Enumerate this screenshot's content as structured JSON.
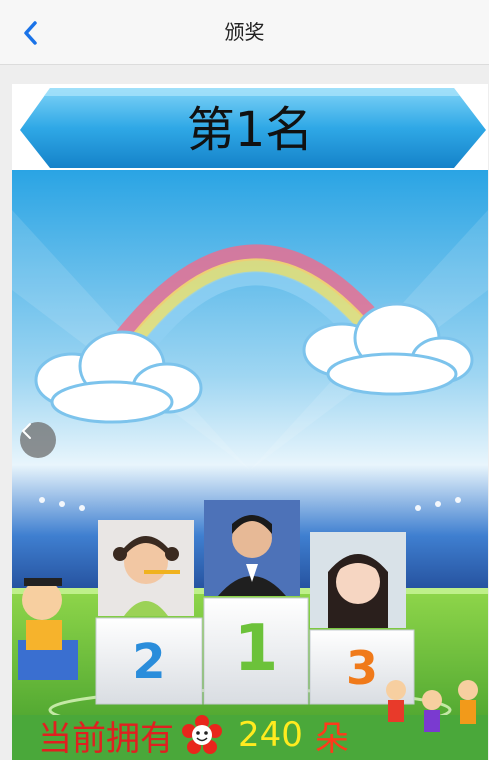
{
  "header": {
    "back_icon": "chevron-left-icon",
    "title": "颁奖"
  },
  "banner": {
    "rank_title": "第1名"
  },
  "carousel": {
    "prev_icon": "chevron-left-icon"
  },
  "podium": {
    "places": [
      "2",
      "1",
      "3"
    ],
    "photos": [
      "child-girl-toothbrush-photo",
      "man-portrait-photo",
      "child-girl-portrait-photo"
    ]
  },
  "points": {
    "label": "当前拥有",
    "icon": "flower-icon",
    "value": "240",
    "unit": "朵"
  },
  "colors": {
    "accent_blue": "#1a73e8",
    "banner_blue": "#2fa8e6",
    "grass_green": "#4aa83a",
    "label_red": "#e02020",
    "value_yellow": "#ffeb1f"
  }
}
